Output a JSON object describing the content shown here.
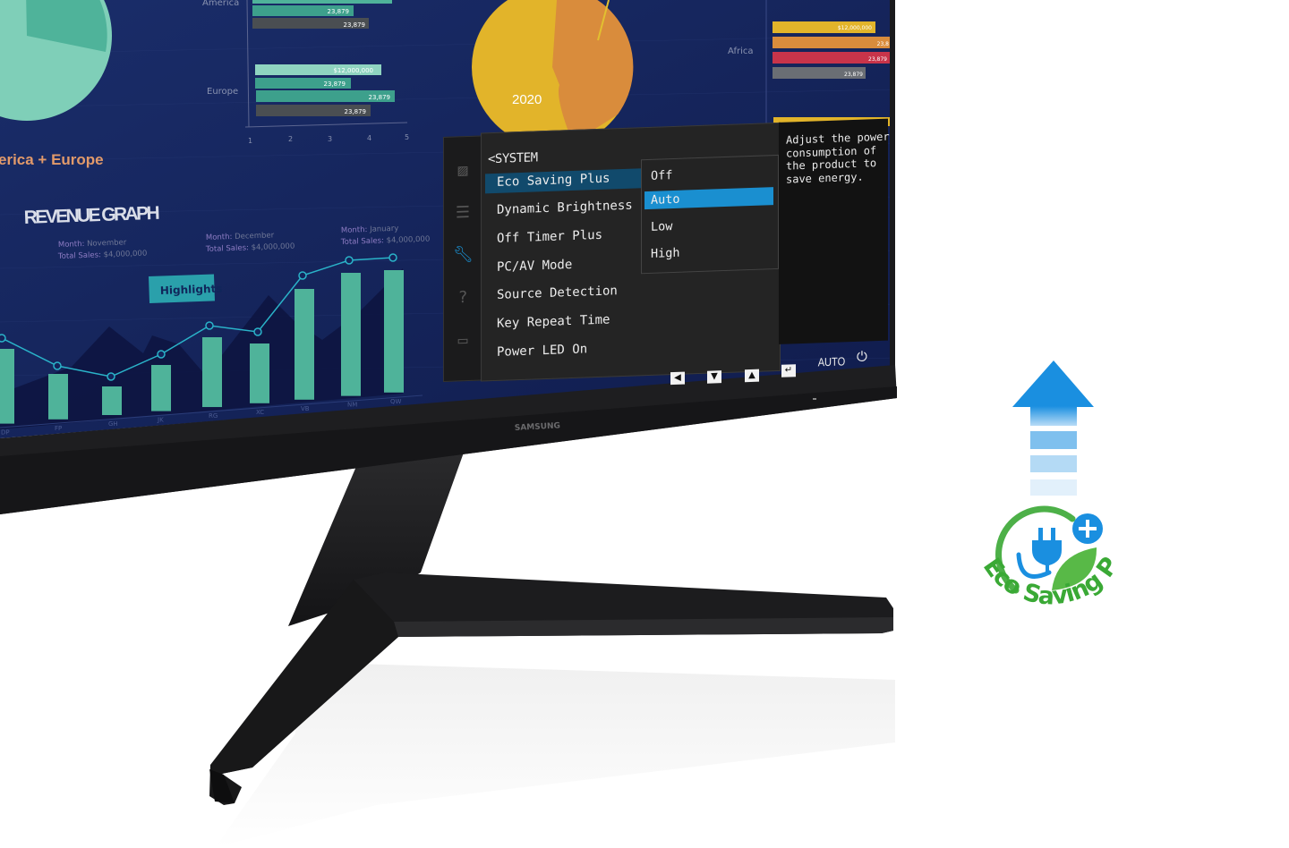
{
  "screen": {
    "pie_left_label": "erica + Europe",
    "pie_right_label": "2020",
    "region_america": "America",
    "region_europe": "Europe",
    "region_africa": "Africa",
    "america_bars": [
      "23,879",
      "23,879"
    ],
    "europe_bars": [
      "$12,000,000",
      "23,879",
      "23,879",
      "23,879"
    ],
    "africa_bars": [
      "$12,000,000",
      "23,8",
      "23,879",
      "23,879"
    ],
    "axis_ticks": [
      "1",
      "2",
      "3",
      "4",
      "5"
    ],
    "revenue_title": "REVENUE GRAPH",
    "highlights": "Highlights",
    "annotations": [
      {
        "month_label": "Month:",
        "month": "November",
        "sales_label": "Total Sales:",
        "sales": "$4,000,000"
      },
      {
        "month_label": "Month:",
        "month": "December",
        "sales_label": "Total Sales:",
        "sales": "$4,000,000"
      },
      {
        "month_label": "Month:",
        "month": "January",
        "sales_label": "Total Sales:",
        "sales": "$4,000,000"
      }
    ],
    "categories": [
      "DP",
      "FP",
      "GH",
      "JK",
      "RG",
      "XC",
      "VB",
      "NM",
      "QW"
    ],
    "colors": {
      "bg": "#14235a",
      "teal": "#4fb39a",
      "yellow": "#e2b42a",
      "orange": "#d98c3c",
      "red": "#c8344a"
    }
  },
  "osd": {
    "icons": [
      "picture-icon",
      "adjust-icon",
      "wrench-icon",
      "help-icon",
      "window-icon"
    ],
    "section_title": "<SYSTEM",
    "menu_items": [
      "Eco Saving Plus",
      "Dynamic Brightness",
      "Off Timer Plus",
      "PC/AV Mode",
      "Source Detection",
      "Key Repeat Time",
      "Power LED On"
    ],
    "options": [
      "Off",
      "Auto",
      "Low",
      "High"
    ],
    "selected_option": "Auto",
    "description": "Adjust the power consumption of the product to save energy.",
    "buttons": [
      "◀",
      "▼",
      "▲",
      "↵"
    ],
    "auto_label": "AUTO",
    "power_icon": "⏻",
    "highlight_color": "#1a8fd0"
  },
  "monitor": {
    "brand": "SAMSUNG"
  },
  "logo": {
    "text": "Eco Saving Plus",
    "arrow_color": "#1a8fe0",
    "green": "#3aa935"
  }
}
